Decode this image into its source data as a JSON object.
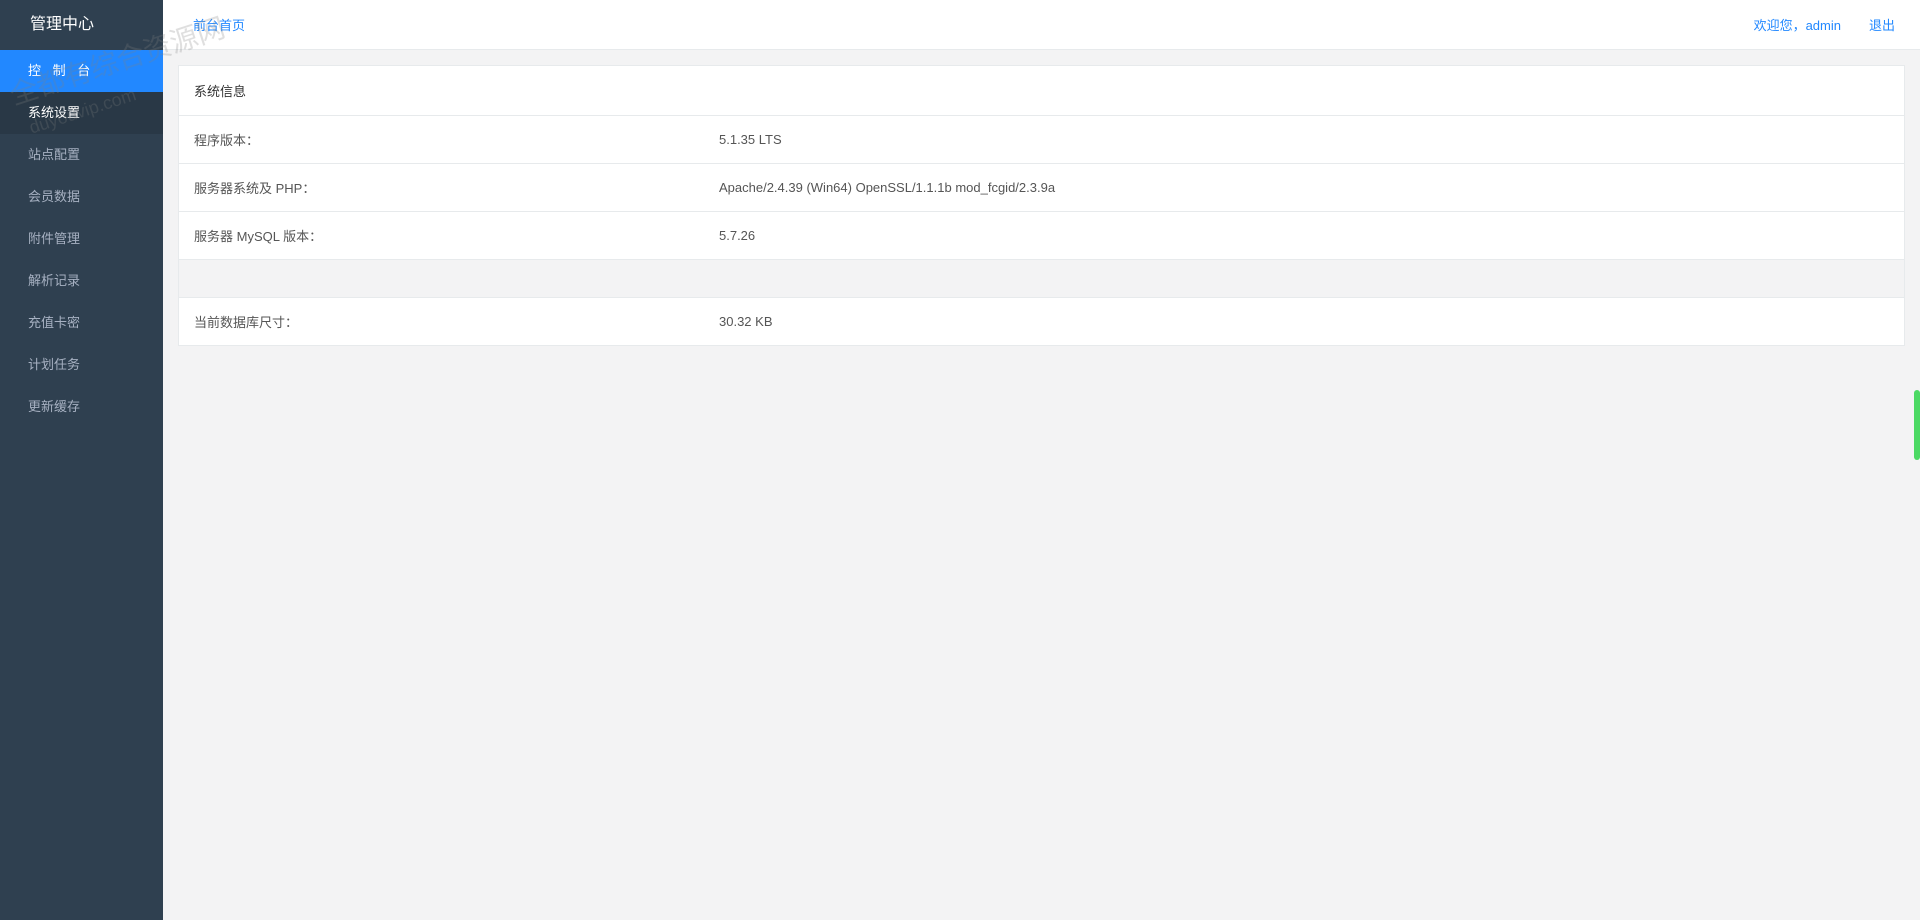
{
  "sidebar": {
    "title": "管理中心",
    "items": [
      {
        "label": "控 制 台",
        "active": true
      },
      {
        "label": "系统设置",
        "highlight": true
      },
      {
        "label": "站点配置"
      },
      {
        "label": "会员数据"
      },
      {
        "label": "附件管理"
      },
      {
        "label": "解析记录"
      },
      {
        "label": "充值卡密"
      },
      {
        "label": "计划任务"
      },
      {
        "label": "更新缓存"
      }
    ]
  },
  "topbar": {
    "home_link": "前台首页",
    "welcome": "欢迎您，admin",
    "logout": "退出"
  },
  "panel": {
    "title": "系统信息",
    "rows": [
      {
        "label": "程序版本：",
        "value": "5.1.35 LTS"
      },
      {
        "label": "服务器系统及 PHP：",
        "value": "Apache/2.4.39 (Win64) OpenSSL/1.1.1b mod_fcgid/2.3.9a"
      },
      {
        "label": "服务器 MySQL 版本：",
        "value": "5.7.26"
      }
    ],
    "rows2": [
      {
        "label": "当前数据库尺寸：",
        "value": "30.32 KB"
      }
    ]
  },
  "watermark": {
    "line1": "全都有综合资源网",
    "line2": "duyouvip.com"
  }
}
